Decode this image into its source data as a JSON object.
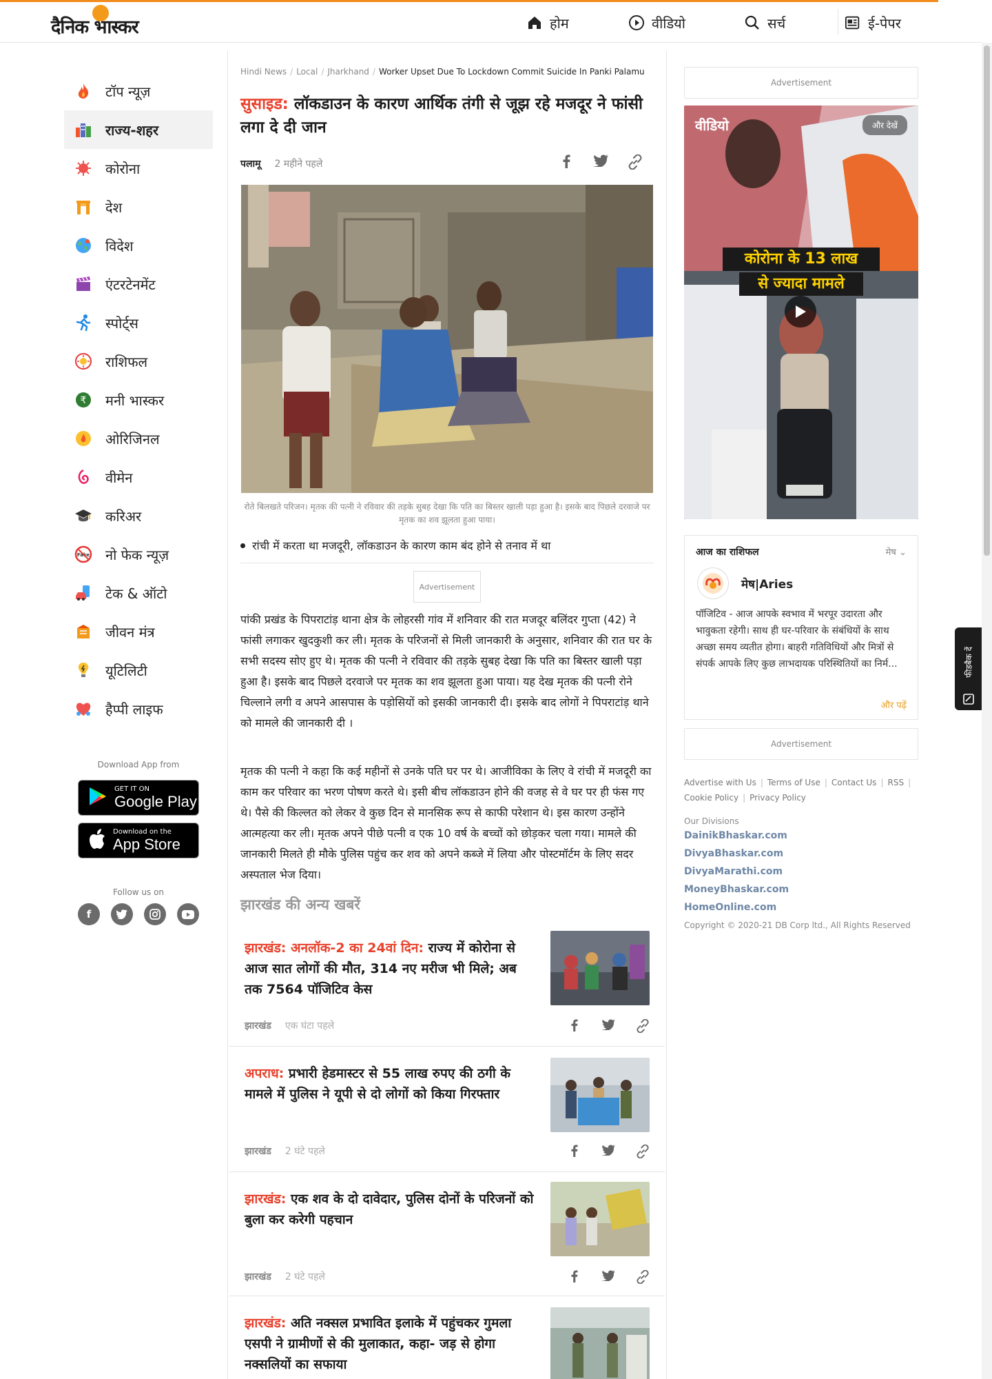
{
  "header": {
    "logo_text": "दैनिक भास्कर",
    "nav": [
      {
        "label": "होम",
        "icon": "home-icon"
      },
      {
        "label": "वीडियो",
        "icon": "play-circle-icon"
      },
      {
        "label": "सर्च",
        "icon": "search-icon"
      },
      {
        "label": "ई-पेपर",
        "icon": "newspaper-icon"
      }
    ],
    "accent_color": "#f18b1c"
  },
  "sidebar": {
    "items": [
      {
        "label": "टॉप न्यूज़",
        "icon": "fire-icon"
      },
      {
        "label": "राज्य-शहर",
        "icon": "city-icon",
        "active": true
      },
      {
        "label": "कोरोना",
        "icon": "virus-icon"
      },
      {
        "label": "देश",
        "icon": "india-gate-icon"
      },
      {
        "label": "विदेश",
        "icon": "globe-icon"
      },
      {
        "label": "एंटरटेनमेंट",
        "icon": "clapperboard-icon"
      },
      {
        "label": "स्पोर्ट्स",
        "icon": "runner-icon"
      },
      {
        "label": "राशिफल",
        "icon": "zodiac-icon"
      },
      {
        "label": "मनी भास्कर",
        "icon": "rupee-icon"
      },
      {
        "label": "ओरिजिनल",
        "icon": "original-icon"
      },
      {
        "label": "वीमेन",
        "icon": "women-icon"
      },
      {
        "label": "करिअर",
        "icon": "graduation-cap-icon"
      },
      {
        "label": "नो फेक न्यूज़",
        "icon": "no-fake-icon"
      },
      {
        "label": "टेक & ऑटो",
        "icon": "tech-auto-icon"
      },
      {
        "label": "जीवन मंत्र",
        "icon": "scroll-icon"
      },
      {
        "label": "यूटिलिटी",
        "icon": "bulb-icon"
      },
      {
        "label": "हैप्पी लाइफ",
        "icon": "happy-heart-icon"
      }
    ],
    "download_label": "Download App from",
    "google_play": {
      "small": "GET IT ON",
      "big": "Google Play"
    },
    "app_store": {
      "small": "Download on the",
      "big": "App Store"
    },
    "follow_label": "Follow us on"
  },
  "article": {
    "breadcrumb": [
      "Hindi News",
      "Local",
      "Jharkhand",
      "Worker Upset Due To Lockdown Commit Suicide In Panki Palamu"
    ],
    "kicker": "सुसाइड:",
    "headline": "लॉकडाउन के कारण आर्थिक तंगी से जूझ रहे मजदूर ने फांसी लगा दे दी जान",
    "location": "पलामू",
    "time": "2 महीने पहले",
    "caption": "रोते बिलखते परिजन। मृतक की पत्नी ने रविवार की तड़के सुबह देखा कि पति का बिस्तर खाली पड़ा हुआ है। इसके बाद पिछले दरवाजे पर मृतक का शव झूलता हुआ पाया।",
    "bullet": "रांची में करता था मजदूरी, लॉकडाउन के कारण काम बंद होने से तनाव में था",
    "ad_label": "Advertisement",
    "para1": "पांकी प्रखंड के पिपराटांड़ थाना क्षेत्र के लोहरसी गांव में शनिवार की रात मजदूर बलिंदर गुप्ता (42) ने फांसी लगाकर खुदकुशी कर ली। मृतक के परिजनों से मिली जानकारी के अनुसार, शनिवार की रात घर के सभी सदस्य सोए हुए थे। मृतक की पत्नी ने रविवार की तड़के सुबह देखा कि पति का बिस्तर खाली पड़ा हुआ है। इसके बाद पिछले दरवाजे पर मृतक का शव झूलता हुआ पाया। यह देख मृतक की पत्नी रोने चिल्लाने लगी व अपने आसपास के पड़ोसियों को इसकी जानकारी दी। इसके बाद लोगों ने पिपराटांड़ थाने को मामले की जानकारी दी ।",
    "para2": "मृतक की पत्नी ने कहा कि कई महीनों से उनके पति घर पर थे। आजीविका के लिए वे रांची में मजदूरी का काम कर परिवार का भरण पोषण करते थे। इसी बीच लॉकडाउन होने की वजह से वे घर पर ही फंस गए थे। पैसे की किल्लत को लेकर वे कुछ दिन से मानसिक रूप से काफी परेशान थे। इस कारण उन्होंने आत्महत्या कर ली। मृतक अपने पीछे पत्नी व एक 10 वर्ष के बच्चों को छोड़कर चला गया। मामले की जानकारी मिलते ही मौके पुलिस पहुंच कर शव को अपने कब्जे में लिया और पोस्टमॉर्टम के लिए सदर अस्पताल भेज दिया।"
  },
  "more_news": {
    "title": "झारखंड की अन्य खबरें",
    "stories": [
      {
        "kicker": "झारखंड: अनलॉक-2 का 24वां दिन:",
        "title": "राज्य में कोरोना से आज सात लोगों की मौत, 314 नए मरीज भी मिले; अब तक 7564 पॉजिटिव केस",
        "source": "झारखंड",
        "time": "एक घंटा पहले"
      },
      {
        "kicker": "अपराध:",
        "title": "प्रभारी हेडमास्टर से 55 लाख रुपए की ठगी के मामले में पुलिस ने यूपी से दो लोगों को किया गिरफ्तार",
        "source": "झारखंड",
        "time": "2 घंटे पहले"
      },
      {
        "kicker": "झारखंड:",
        "title": "एक शव के दो दावेदार, पुलिस दोनों के परिजनों को बुला कर करेगी पहचान",
        "source": "झारखंड",
        "time": "2 घंटे पहले"
      },
      {
        "kicker": "झारखंड:",
        "title": "अति नक्सल प्रभावित इलाके में पहुंचकर गुमला एसपी ने ग्रामीणों से की मुलाकात, कहा- जड़ से होगा नक्सलियों का सफाया",
        "source": "झारखंड",
        "time": ""
      }
    ]
  },
  "right_rail": {
    "ad_label": "Advertisement",
    "video": {
      "title": "वीडियो",
      "more": "और देखें",
      "banner_line1": "कोरोना के 13 लाख",
      "banner_line2": "से ज्यादा मामले"
    },
    "rashifal": {
      "title": "आज का राशिफल",
      "selected": "मेष",
      "sign_name": "मेष|Aries",
      "text": "पॉजिटिव - आज आपके स्वभाव में भरपूर उदारता और भावुकता रहेगी। साथ ही घर-परिवार के संबंधियों के साथ अच्छा समय व्यतीत होगा। बाहरी गतिविधियों और मित्रों से संपर्क आपके लिए कुछ लाभदायक परिस्थितियों का निर्म...",
      "more": "और पढ़ें"
    },
    "footer_links": [
      "Advertise with Us",
      "Terms of Use",
      "Contact Us",
      "RSS",
      "Cookie Policy",
      "Privacy Policy"
    ],
    "divisions_label": "Our Divisions",
    "divisions": [
      "DainikBhaskar.com",
      "DivyaBhaskar.com",
      "DivyaMarathi.com",
      "MoneyBhaskar.com",
      "HomeOnline.com"
    ],
    "copyright": "Copyright © 2020-21 DB Corp ltd., All Rights Reserved"
  },
  "feedback": {
    "label": "फीडबैक दें"
  }
}
